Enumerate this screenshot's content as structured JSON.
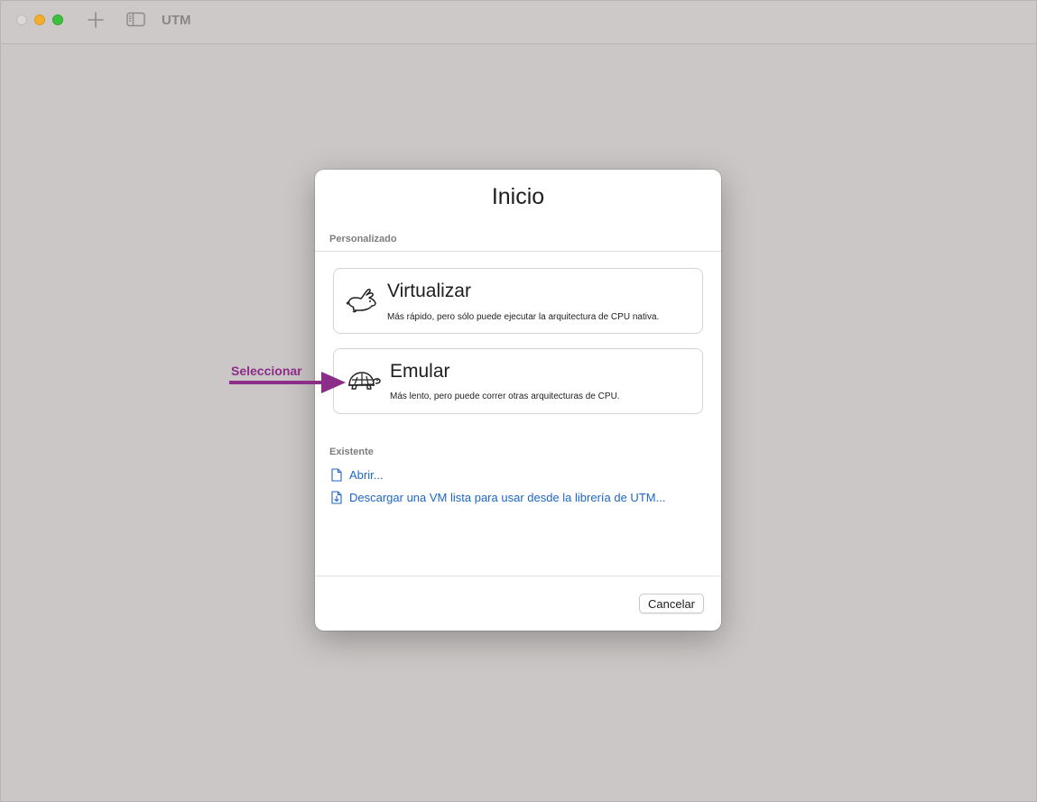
{
  "window": {
    "app_title": "UTM"
  },
  "dialog": {
    "title": "Inicio",
    "custom_section": "Personalizado",
    "options": [
      {
        "title": "Virtualizar",
        "description": "Más rápido, pero sólo puede ejecutar la arquitectura de CPU nativa.",
        "icon": "hare-icon"
      },
      {
        "title": "Emular",
        "description": "Más lento, pero puede correr otras arquitecturas de CPU.",
        "icon": "tortoise-icon"
      }
    ],
    "existing_section": "Existente",
    "links": [
      {
        "label": "Abrir...",
        "icon": "document-icon"
      },
      {
        "label": "Descargar una VM lista para usar desde la librería de UTM...",
        "icon": "document-download-icon"
      }
    ],
    "cancel_label": "Cancelar"
  },
  "annotation": {
    "label": "Seleccionar",
    "color": "#8c2d8a"
  },
  "colors": {
    "background": "#cbc7c6",
    "link": "#1d66c8",
    "close": "#dcd8d7",
    "minimize": "#f5ad2e",
    "maximize": "#3ec03e"
  }
}
